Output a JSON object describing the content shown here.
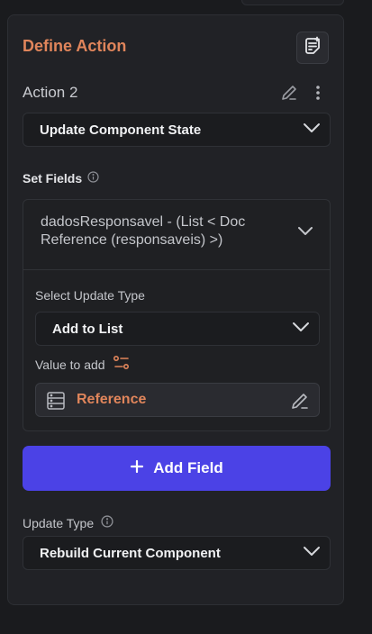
{
  "panel": {
    "title": "Define Action",
    "action_label": "Action 2",
    "action_type": "Update Component State"
  },
  "set_fields": {
    "label": "Set Fields",
    "field_name": "dadosResponsavel - (List < Doc Reference (responsaveis) >)",
    "select_update_type_label": "Select Update Type",
    "update_type_value": "Add to List",
    "value_to_add_label": "Value to add",
    "value_reference": "Reference"
  },
  "add_field": {
    "label": "Add Field"
  },
  "update_type": {
    "label": "Update Type",
    "value": "Rebuild Current Component"
  },
  "colors": {
    "accent": "#e0855b",
    "primary_button": "#4b42e6",
    "panel_bg": "#212226"
  },
  "icons": [
    "add-note-icon",
    "edit-icon",
    "kebab-icon",
    "chevron-down-icon",
    "info-icon",
    "variable-icon",
    "database-icon",
    "plus-icon"
  ]
}
